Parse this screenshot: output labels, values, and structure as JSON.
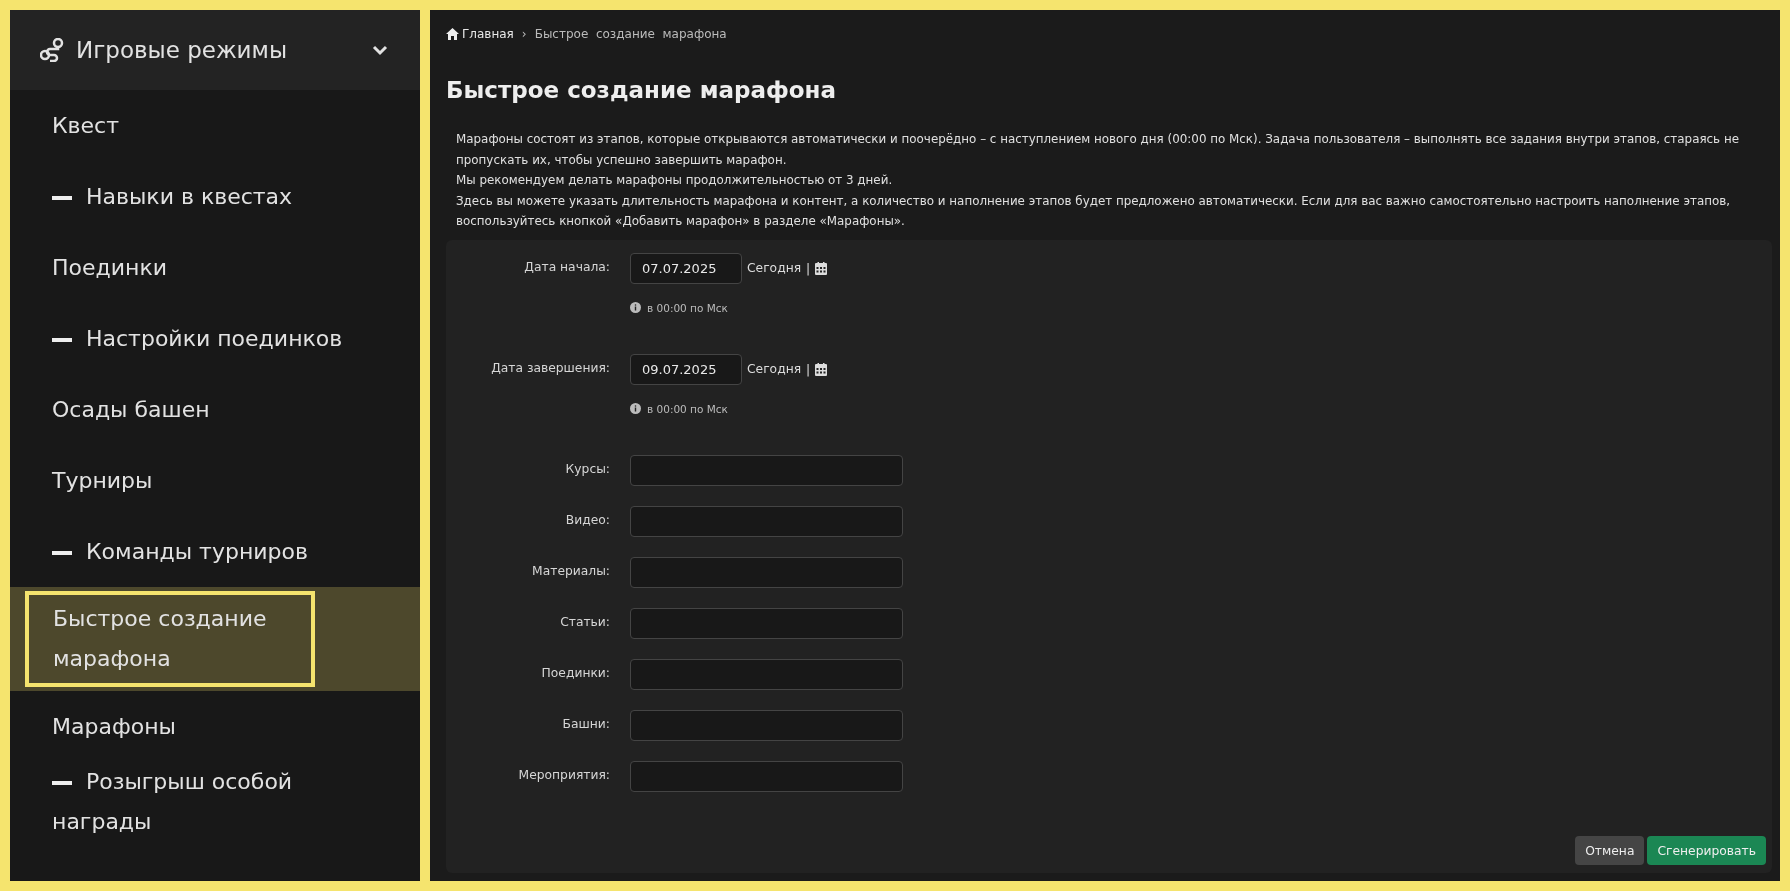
{
  "sidebar": {
    "section": {
      "label": "Игровые режимы",
      "expanded": true
    },
    "items": [
      {
        "label": "Квест",
        "selected": false,
        "children": [
          {
            "label": "Навыки в квестах",
            "selected": false
          }
        ]
      },
      {
        "label": "Поединки",
        "selected": false,
        "children": [
          {
            "label": "Настройки поединков",
            "selected": false
          }
        ]
      },
      {
        "label": "Осады башен",
        "selected": false
      },
      {
        "label": "Турниры",
        "selected": false,
        "children": [
          {
            "label": "Команды турниров",
            "selected": false
          }
        ]
      },
      {
        "label": "Быстрое создание марафона",
        "selected": true
      },
      {
        "label": "Марафоны",
        "selected": false,
        "children": [
          {
            "label": "Розыгрыш особой награды",
            "selected": false
          }
        ]
      }
    ]
  },
  "breadcrumb": {
    "home": "Главная",
    "separator": "›",
    "current": "Быстрое  создание  марафона"
  },
  "title": "Быстрое создание марафона",
  "description": [
    "Марафоны состоят из этапов, которые открываются автоматически и поочерёдно – с наступлением нового дня (00:00 по Мск). Задача пользователя – выполнять все задания внутри этапов, стараясь не пропускать их, чтобы успешно завершить марафон.",
    "Мы рекомендуем делать марафоны продолжительностью от 3 дней.",
    "Здесь вы можете указать длительность марафона и контент, а количество и наполнение этапов будет предложено автоматически. Если для вас важно самостоятельно настроить наполнение этапов, воспользуйтесь кнопкой «Добавить марафон» в разделе «Марафоны»."
  ],
  "form": {
    "fields": [
      {
        "kind": "date",
        "label": "Дата начала:",
        "value": "07.07.2025",
        "today": "Сегодня",
        "separator": "|",
        "hint": "в 00:00 по Мск"
      },
      {
        "kind": "date",
        "label": "Дата завершения:",
        "value": "09.07.2025",
        "today": "Сегодня",
        "separator": "|",
        "hint": "в 00:00 по Мск"
      },
      {
        "kind": "text",
        "label": "Курсы:"
      },
      {
        "kind": "text",
        "label": "Видео:"
      },
      {
        "kind": "text",
        "label": "Материалы:"
      },
      {
        "kind": "text",
        "label": "Статьи:"
      },
      {
        "kind": "text",
        "label": "Поединки:"
      },
      {
        "kind": "text",
        "label": "Башни:"
      },
      {
        "kind": "text",
        "label": "Мероприятия:"
      }
    ],
    "buttons": [
      {
        "kind": "secondary",
        "label": "Отмена"
      },
      {
        "kind": "primary",
        "label": "Сгенерировать"
      }
    ]
  }
}
